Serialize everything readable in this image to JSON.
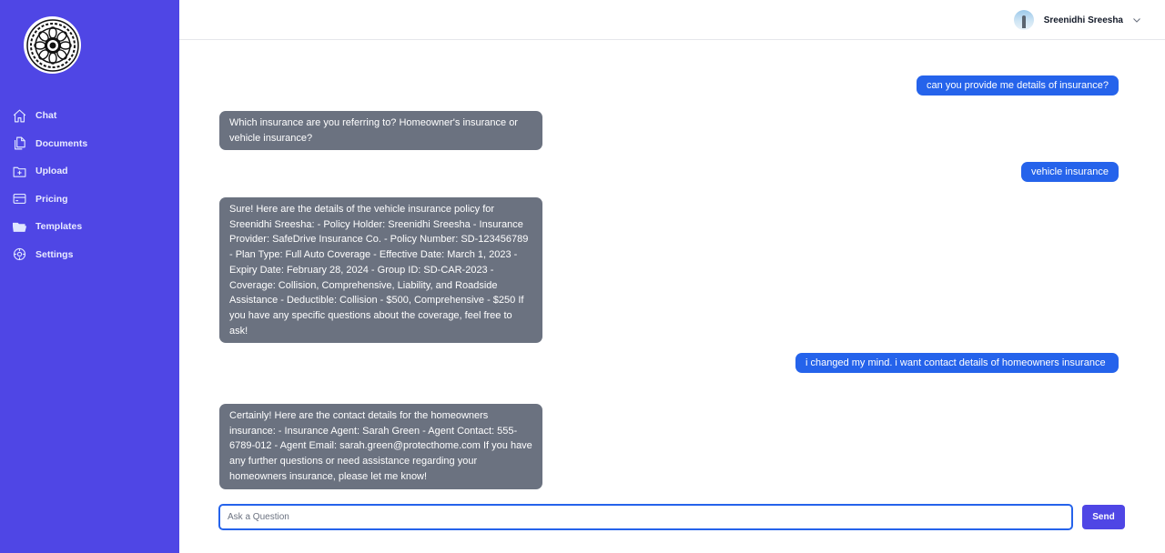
{
  "sidebar": {
    "logo_icon": "mandala-logo-icon",
    "items": [
      {
        "label": "Chat",
        "icon": "home-icon"
      },
      {
        "label": "Documents",
        "icon": "documents-icon"
      },
      {
        "label": "Upload",
        "icon": "upload-icon"
      },
      {
        "label": "Pricing",
        "icon": "credit-card-icon"
      },
      {
        "label": "Templates",
        "icon": "folder-icon"
      },
      {
        "label": "Settings",
        "icon": "gear-icon"
      }
    ],
    "colors": {
      "background": "#4f46e5"
    }
  },
  "header": {
    "user_name": "Sreenidhi Sreesha"
  },
  "chat": {
    "messages": [
      {
        "role": "user",
        "text": "can you provide me details of insurance?"
      },
      {
        "role": "assistant",
        "text": "Which insurance are you referring to? Homeowner's insurance or vehicle insurance?"
      },
      {
        "role": "user",
        "text": "vehicle insurance"
      },
      {
        "role": "assistant",
        "text": "Sure! Here are the details of the vehicle insurance policy for Sreenidhi Sreesha: - Policy Holder: Sreenidhi Sreesha - Insurance Provider: SafeDrive Insurance Co. - Policy Number: SD-123456789 - Plan Type: Full Auto Coverage - Effective Date: March 1, 2023 - Expiry Date: February 28, 2024 - Group ID: SD-CAR-2023 - Coverage: Collision, Comprehensive, Liability, and Roadside Assistance - Deductible: Collision - $500, Comprehensive - $250 If you have any specific questions about the coverage, feel free to ask!"
      },
      {
        "role": "user",
        "text": "i changed my mind. i want contact details of homeowners insurance"
      },
      {
        "role": "assistant",
        "text": "Certainly! Here are the contact details for the homeowners insurance: - Insurance Agent: Sarah Green - Agent Contact: 555-6789-012 - Agent Email: sarah.green@protecthome.com If you have any further questions or need assistance regarding your homeowners insurance, please let me know!"
      }
    ],
    "colors": {
      "user_bubble": "#2563eb",
      "assistant_bubble": "#6b7280"
    }
  },
  "composer": {
    "placeholder": "Ask a Question",
    "value": "",
    "send_label": "Send"
  }
}
